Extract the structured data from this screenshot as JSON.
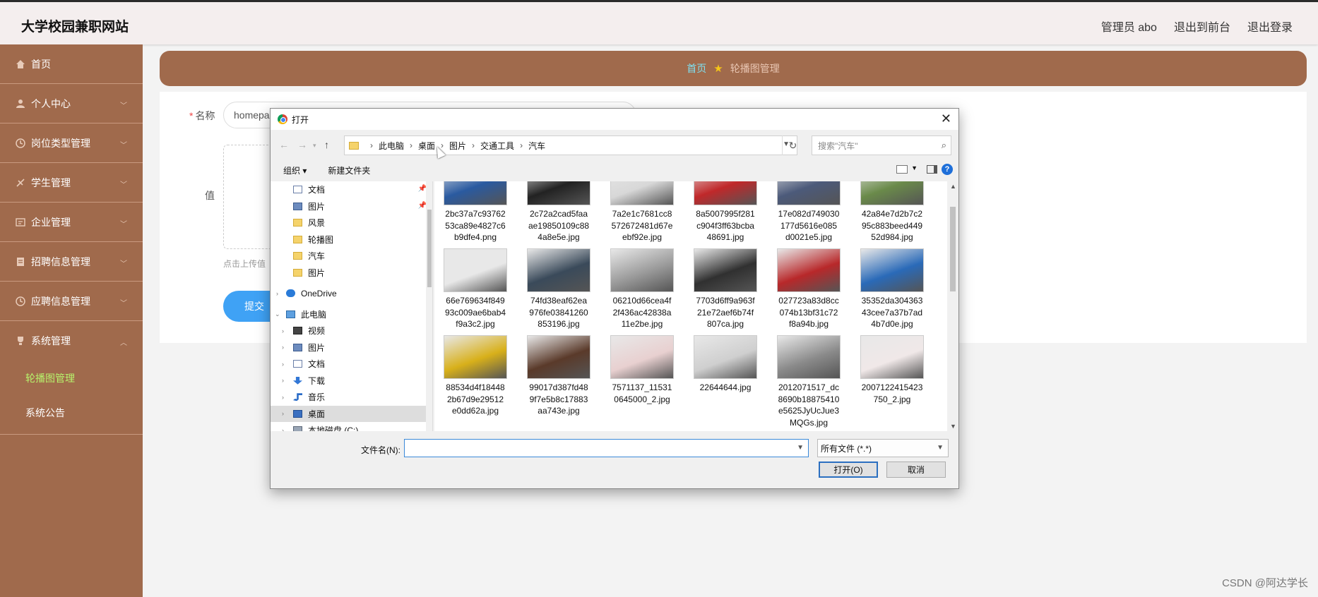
{
  "header": {
    "site_title": "大学校园兼职网站",
    "admin_label": "管理员 abo",
    "to_frontend": "退出到前台",
    "logout": "退出登录"
  },
  "sidebar": {
    "items": [
      {
        "label": "首页",
        "icon": "home-icon"
      },
      {
        "label": "个人中心",
        "icon": "user-icon"
      },
      {
        "label": "岗位类型管理",
        "icon": "clock-icon"
      },
      {
        "label": "学生管理",
        "icon": "student-icon"
      },
      {
        "label": "企业管理",
        "icon": "building-icon"
      },
      {
        "label": "招聘信息管理",
        "icon": "doc-icon"
      },
      {
        "label": "应聘信息管理",
        "icon": "clock-icon"
      },
      {
        "label": "系统管理",
        "icon": "trophy-icon"
      }
    ],
    "sub_items": [
      {
        "label": "轮播图管理",
        "active": true
      },
      {
        "label": "系统公告",
        "active": false
      }
    ]
  },
  "breadcrumb": {
    "home": "首页",
    "current": "轮播图管理"
  },
  "form": {
    "name_label": "名称",
    "name_value": "homepa",
    "value_label": "值",
    "upload_hint": "点击上传值",
    "submit": "提交"
  },
  "dialog": {
    "title": "打开",
    "path": [
      "此电脑",
      "桌面",
      "图片",
      "交通工具",
      "汽车"
    ],
    "search_placeholder": "搜索\"汽车\"",
    "organize": "组织 ▾",
    "new_folder": "新建文件夹",
    "tree": [
      {
        "label": "文档",
        "icon": "document-icon",
        "pinned": true
      },
      {
        "label": "图片",
        "icon": "pictures-icon",
        "pinned": true
      },
      {
        "label": "风景",
        "icon": "folder-icon"
      },
      {
        "label": "轮播图",
        "icon": "folder-icon"
      },
      {
        "label": "汽车",
        "icon": "folder-icon"
      },
      {
        "label": "图片",
        "icon": "folder-icon"
      },
      {
        "label": "OneDrive",
        "icon": "cloud-icon"
      },
      {
        "label": "此电脑",
        "icon": "computer-icon"
      },
      {
        "label": "视频",
        "icon": "video-icon"
      },
      {
        "label": "图片",
        "icon": "pictures-icon"
      },
      {
        "label": "文档",
        "icon": "document-icon"
      },
      {
        "label": "下载",
        "icon": "download-icon"
      },
      {
        "label": "音乐",
        "icon": "music-icon"
      },
      {
        "label": "桌面",
        "icon": "desktop-icon",
        "selected": true
      },
      {
        "label": "本地磁盘 (C:)",
        "icon": "drive-icon"
      }
    ],
    "files": [
      {
        "name": "2bc37a7c93762\n53ca89e4827c6\nb9dfe4.png",
        "color": "#2a5aa0"
      },
      {
        "name": "2c72a2cad5faa\nae19850109c88\n4a8e5e.jpg",
        "color": "#222222"
      },
      {
        "name": "7a2e1c7681cc8\n572672481d67e\nebf92e.jpg",
        "color": "#d8d8d8"
      },
      {
        "name": "8a5007995f281\nc904f3ff63bcba\n48691.jpg",
        "color": "#c0282a"
      },
      {
        "name": "17e082d749030\n177d5616e085\nd0021e5.jpg",
        "color": "#4c5a7a"
      },
      {
        "name": "42a84e7d2b7c2\n95c883beed449\n52d984.jpg",
        "color": "#6a8a4a"
      },
      {
        "name": "66e769634f849\n93c009ae6bab4\nf9a3c2.jpg",
        "color": "#e8e8e8"
      },
      {
        "name": "74fd38eaf62ea\n976fe03841260\n853196.jpg",
        "color": "#3a4a5a"
      },
      {
        "name": "06210d66cea4f\n2f436ac42838a\n11e2be.jpg",
        "color": "#9a9a9a"
      },
      {
        "name": "7703d6ff9a963f\n21e72aef6b74f\n807ca.jpg",
        "color": "#303030"
      },
      {
        "name": "027723a83d8cc\n074b13bf31c72\nf8a94b.jpg",
        "color": "#b8282a"
      },
      {
        "name": "35352da304363\n43cee7a37b7ad\n4b7d0e.jpg",
        "color": "#2a6ab8"
      },
      {
        "name": "88534d4f18448\n2b67d9e29512\ne0dd62a.jpg",
        "color": "#d8b01a"
      },
      {
        "name": "99017d387fd48\n9f7e5b8c17883\naa743e.jpg",
        "color": "#5a3a2a"
      },
      {
        "name": "7571137_11531\n0645000_2.jpg",
        "color": "#e8d0d0"
      },
      {
        "name": "22644644.jpg",
        "color": "#cfcfcf"
      },
      {
        "name": "2012071517_dc\n8690b18875410\ne5625JyUcJue3\nMQGs.jpg",
        "color": "#8a8a8a"
      },
      {
        "name": "2007122415423\n750_2.jpg",
        "color": "#f0e8e8"
      }
    ],
    "filename_label": "文件名(N):",
    "filename_value": "",
    "filetype": "所有文件 (*.*)",
    "open_btn": "打开(O)",
    "cancel_btn": "取消"
  },
  "watermark": "CSDN @阿达学长"
}
